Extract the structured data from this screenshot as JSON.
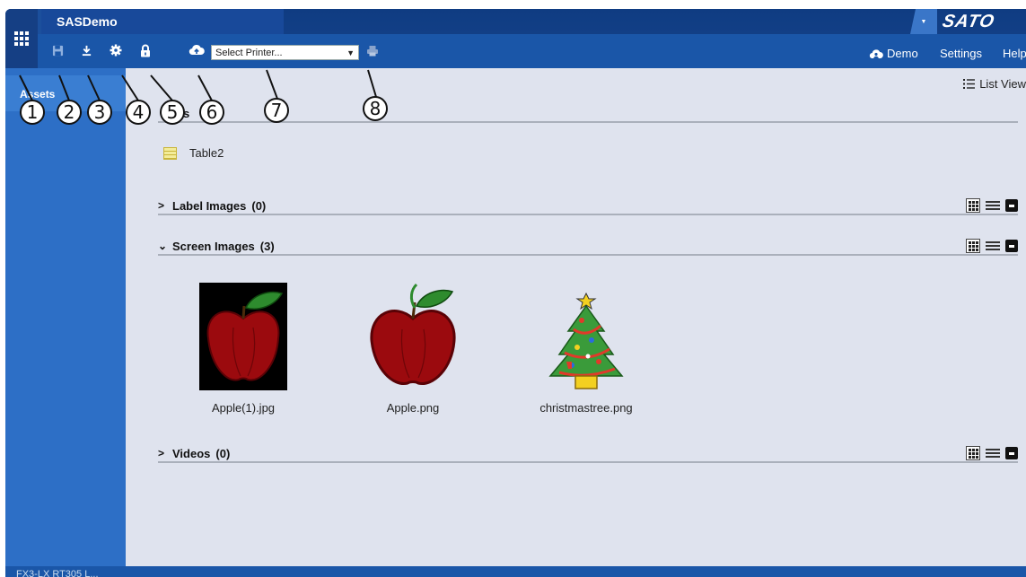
{
  "app": {
    "title": "SASDemo",
    "brand": "SATO"
  },
  "toolbar": {
    "printer_placeholder": "Select Printer...",
    "icons": [
      "apps-grid-icon",
      "save-icon",
      "download-icon",
      "gear-icon",
      "lock-icon",
      "cloud-upload-icon",
      "print-icon"
    ]
  },
  "header_right": {
    "demo_label": "Demo",
    "settings_label": "Settings",
    "help_label": "Help"
  },
  "sidebar": {
    "items": [
      {
        "label": "Assets"
      }
    ]
  },
  "main": {
    "view_toggle_label": "List View",
    "tables_header_partial": "s",
    "table_name": "Table2",
    "sections": [
      {
        "label": "Label Images",
        "count": "(0)",
        "expanded": false
      },
      {
        "label": "Screen Images",
        "count": "(3)",
        "expanded": true
      },
      {
        "label": "Videos",
        "count": "(0)",
        "expanded": false
      }
    ],
    "screen_images": [
      {
        "name": "Apple(1).jpg"
      },
      {
        "name": "Apple.png"
      },
      {
        "name": "christmastree.png"
      }
    ]
  },
  "footer": {
    "text": "FX3-LX RT305 L..."
  },
  "badges": [
    "1",
    "2",
    "3",
    "4",
    "5",
    "6",
    "7",
    "8"
  ],
  "colors": {
    "topbar": "#1b4f9c",
    "sidebar": "#2d6fc6",
    "main_bg": "#dfe3ee",
    "apple_red": "#9b0a0e",
    "leaf_green": "#2e8b2e"
  }
}
